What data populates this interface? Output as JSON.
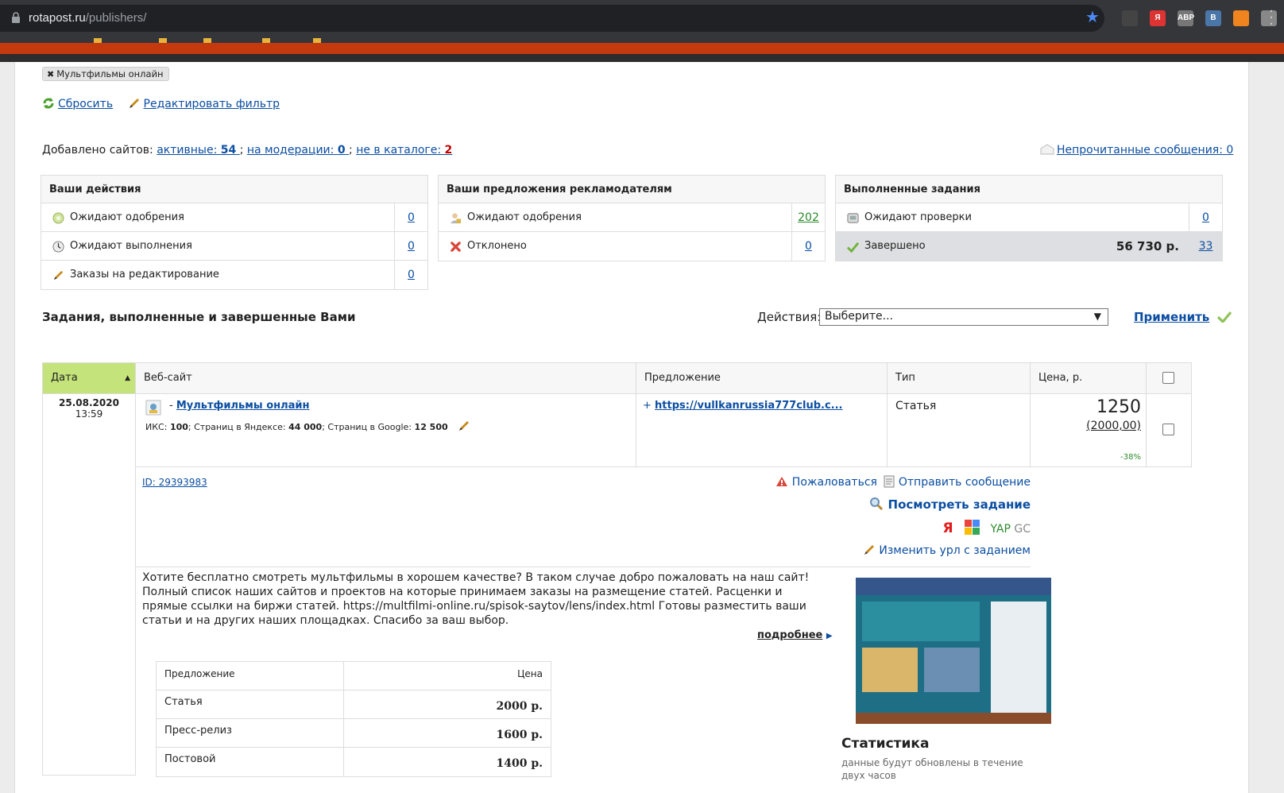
{
  "browser": {
    "url_domain": "rotapost.ru",
    "url_path": "/publishers/",
    "extensions": [
      {
        "name": "ext-icon-1",
        "label": "",
        "color": "#444"
      },
      {
        "name": "yandex-ext-icon",
        "label": "Я",
        "color": "#d33"
      },
      {
        "name": "adblock-ext-icon",
        "label": "ABP",
        "color": "#777"
      },
      {
        "name": "vk-ext-icon",
        "label": "B",
        "color": "#4a76a8"
      },
      {
        "name": "rss-ext-icon",
        "label": "",
        "color": "#f0841e"
      },
      {
        "name": "ext-icon-6",
        "label": "",
        "color": "#888"
      }
    ]
  },
  "filter": {
    "tag": "Мультфильмы онлайн",
    "reset": "Сбросить",
    "edit": "Редактировать фильтр"
  },
  "summary": {
    "prefix": "Добавлено сайтов:",
    "active_label": "активные:",
    "active_count": "54",
    "moderation_label": "на модерации:",
    "moderation_count": "0",
    "not_catalog_label": "не в каталоге:",
    "not_catalog_count": "2",
    "unread": "Непрочитанные сообщения: 0"
  },
  "boxes": {
    "actions": {
      "title": "Ваши действия",
      "rows": [
        {
          "label": "Ожидают одобрения",
          "count": "0"
        },
        {
          "label": "Ожидают выполнения",
          "count": "0"
        },
        {
          "label": "Заказы на редактирование",
          "count": "0"
        }
      ]
    },
    "offers": {
      "title": "Ваши предложения рекламодателям",
      "rows": [
        {
          "label": "Ожидают одобрения",
          "count": "202"
        },
        {
          "label": "Отклонено",
          "count": "0"
        }
      ]
    },
    "completed": {
      "title": "Выполненные задания",
      "rows": [
        {
          "label": "Ожидают проверки",
          "count": "0"
        },
        {
          "label": "Завершено",
          "sum": "56 730 р.",
          "count": "33"
        }
      ]
    }
  },
  "tasks": {
    "title": "Задания, выполненные и завершенные Вами",
    "actions_label": "Действия:",
    "select_value": "Выберите...",
    "apply": "Применить",
    "columns": [
      "Дата",
      "Веб-сайт",
      "Предложение",
      "Тип",
      "Цена, р."
    ],
    "row": {
      "date": "25.08.2020",
      "time": "13:59",
      "site_prefix": "-",
      "site_name": "Мультфильмы онлайн",
      "iks_label": "ИКС:",
      "iks": "100",
      "yandex_pages_label": "; Страниц в Яндексе:",
      "yandex_pages": "44 000",
      "google_pages_label": "; Страниц в Google:",
      "google_pages": "12 500",
      "offer_prefix": "+",
      "offer_link": "https://vullkanrussia777club.c...",
      "type": "Статья",
      "price": "1250",
      "price_orig": "(2000,00)",
      "discount": "-38%",
      "id": "ID: 29393983",
      "complain": "Пожаловаться",
      "send_message": "Отправить сообщение",
      "view_task": "Посмотреть задание",
      "yap": "YAP",
      "gc": "GC",
      "change_url": "Изменить урл с заданием",
      "description": "Хотите бесплатно смотреть мультфильмы в хорошем качестве? В таком случае добро пожаловать на наш сайт! Полный список наших сайтов и проектов на которые принимаем заказы на размещение статей. Расценки и прямые ссылки на биржи статей. https://multfilmi-online.ru/spisok-saytov/lens/index.html Готовы разместить ваши статьи и на других наших площадках. Спасибо за ваш выбор.",
      "more": "подробнее",
      "stats_title": "Статистика",
      "stats_text": "данные будут обновлены в течение двух часов"
    },
    "prices": {
      "header_offer": "Предложение",
      "header_price": "Цена",
      "rows": [
        {
          "name": "Статья",
          "price": "2000 р."
        },
        {
          "name": "Пресс-релиз",
          "price": "1600 р."
        },
        {
          "name": "Постовой",
          "price": "1400 р."
        }
      ]
    }
  }
}
